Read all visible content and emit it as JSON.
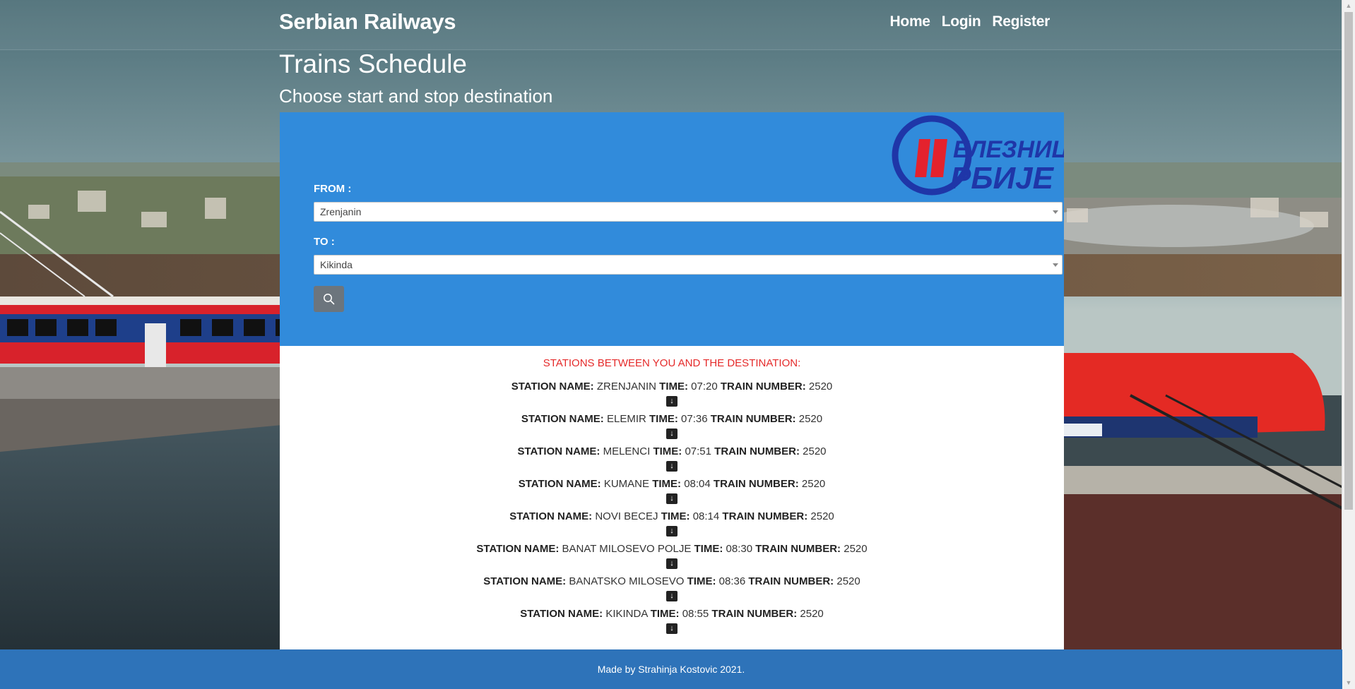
{
  "brand": "Serbian Railways",
  "nav": {
    "home": "Home",
    "login": "Login",
    "register": "Register"
  },
  "page": {
    "title": "Trains Schedule",
    "subtitle": "Choose start and stop destination"
  },
  "logo": {
    "icon": "serbian-railways-logo",
    "text_line1": "ЕЛЕЗНИЦЕ",
    "text_line2": "РБИЈЕ",
    "color": "#1f36a8",
    "accent": "#e4222d"
  },
  "search": {
    "from_label": "FROM :",
    "from_value": "Zrenjanin",
    "to_label": "TO :",
    "to_value": "Kikinda",
    "button_icon": "search-icon"
  },
  "results": {
    "title": "STATIONS BETWEEN YOU AND THE DESTINATION:",
    "station_label": "STATION NAME:",
    "time_label": "TIME:",
    "train_label": "TRAIN NUMBER:",
    "arrow_icon": "arrow-down-icon",
    "stations": [
      {
        "name": "ZRENJANIN",
        "time": "07:20",
        "train": "2520"
      },
      {
        "name": "ELEMIR",
        "time": "07:36",
        "train": "2520"
      },
      {
        "name": "MELENCI",
        "time": "07:51",
        "train": "2520"
      },
      {
        "name": "KUMANE",
        "time": "08:04",
        "train": "2520"
      },
      {
        "name": "NOVI BECEJ",
        "time": "08:14",
        "train": "2520"
      },
      {
        "name": "BANAT MILOSEVO POLJE",
        "time": "08:30",
        "train": "2520"
      },
      {
        "name": "BANATSKO MILOSEVO",
        "time": "08:36",
        "train": "2520"
      },
      {
        "name": "KIKINDA",
        "time": "08:55",
        "train": "2520"
      }
    ]
  },
  "footer": {
    "text": "Made by Strahinja Kostovic 2021."
  },
  "colors": {
    "panel": "#318bdb",
    "footer": "#2e73b9",
    "results_title": "#e52a2a",
    "button": "#6c757d"
  }
}
